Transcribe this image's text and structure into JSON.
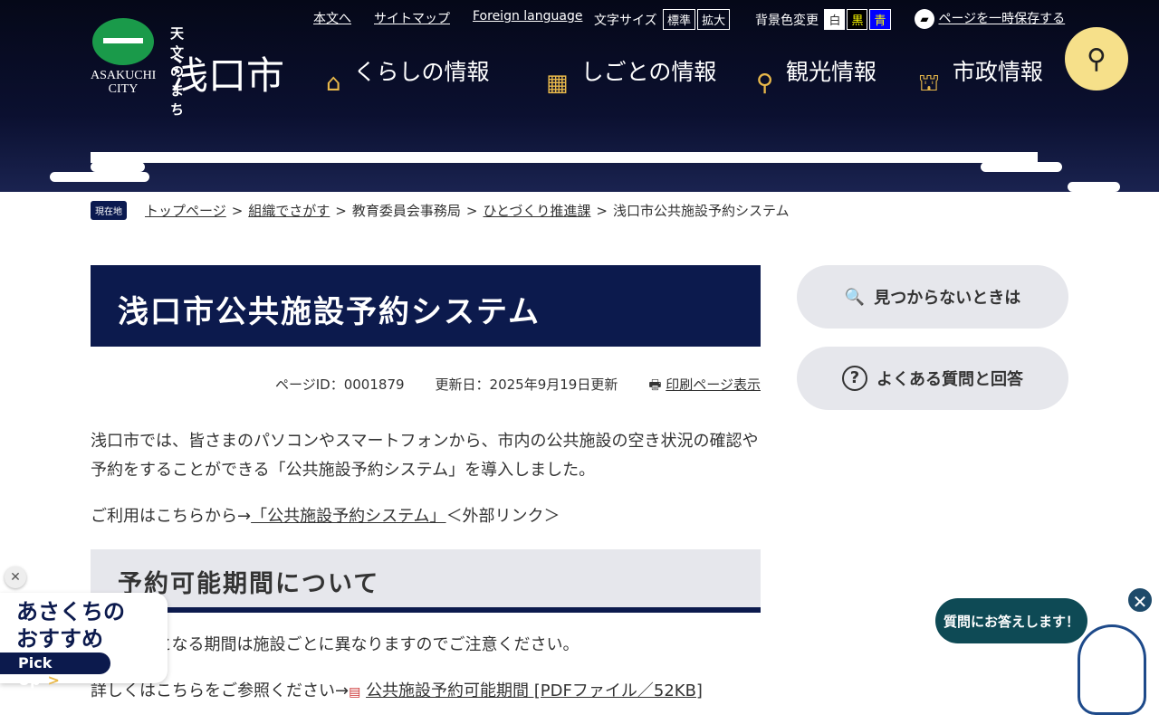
{
  "header": {
    "logo_jp": "天文のまち",
    "logo_city": "浅口市",
    "logo_en": "ASAKUCHI CITY",
    "links": [
      "本文へ",
      "サイトマップ",
      "Foreign language"
    ],
    "font_size_label": "文字サイズ",
    "font_sizes": [
      "標準",
      "拡大"
    ],
    "bg_label": "背景色変更",
    "bg_options": [
      "白",
      "黒",
      "青"
    ],
    "save_page": "ページを一時保存する",
    "nav": [
      {
        "label": "くらしの情報",
        "icon": "house-icon"
      },
      {
        "label": "しごとの情報",
        "icon": "building-icon"
      },
      {
        "label": "観光情報",
        "icon": "map-pin-icon"
      },
      {
        "label": "市政情報",
        "icon": "city-hall-icon"
      }
    ]
  },
  "breadcrumb": {
    "here": "現在地",
    "items": [
      "トップページ",
      "組織でさがす",
      "教育委員会事務局",
      "ひとづくり推進課",
      "浅口市公共施設予約システム"
    ]
  },
  "page": {
    "title": "浅口市公共施設予約システム",
    "page_id": "ページID：0001879",
    "updated": "更新日：2025年9月19日更新",
    "print": "印刷ページ表示",
    "intro": "浅口市では、皆さまのパソコンやスマートフォンから、市内の公共施設の空き状況の確認や予約をすることができる「公共施設予約システム」を導入しました。",
    "usage_prefix": "ご利用はこちらから→",
    "usage_link": "「公共施設予約システム」",
    "usage_suffix": "＜外部リンク＞",
    "h2": "予約可能期間について",
    "p2": "予約可能となる期間は施設ごとに異なりますのでご注意ください。",
    "p3_prefix": "詳しくはこちらをご参照ください→",
    "p3_link": "公共施設予約可能期間 [PDFファイル／52KB]"
  },
  "sidebar": {
    "not_found": "見つからないときは",
    "faq": "よくある質問と回答"
  },
  "pickup": {
    "title1": "あさくちの",
    "title2": "おすすめ",
    "button": "Pick Up"
  },
  "chat": {
    "bubble": "質問にお答えします！"
  }
}
